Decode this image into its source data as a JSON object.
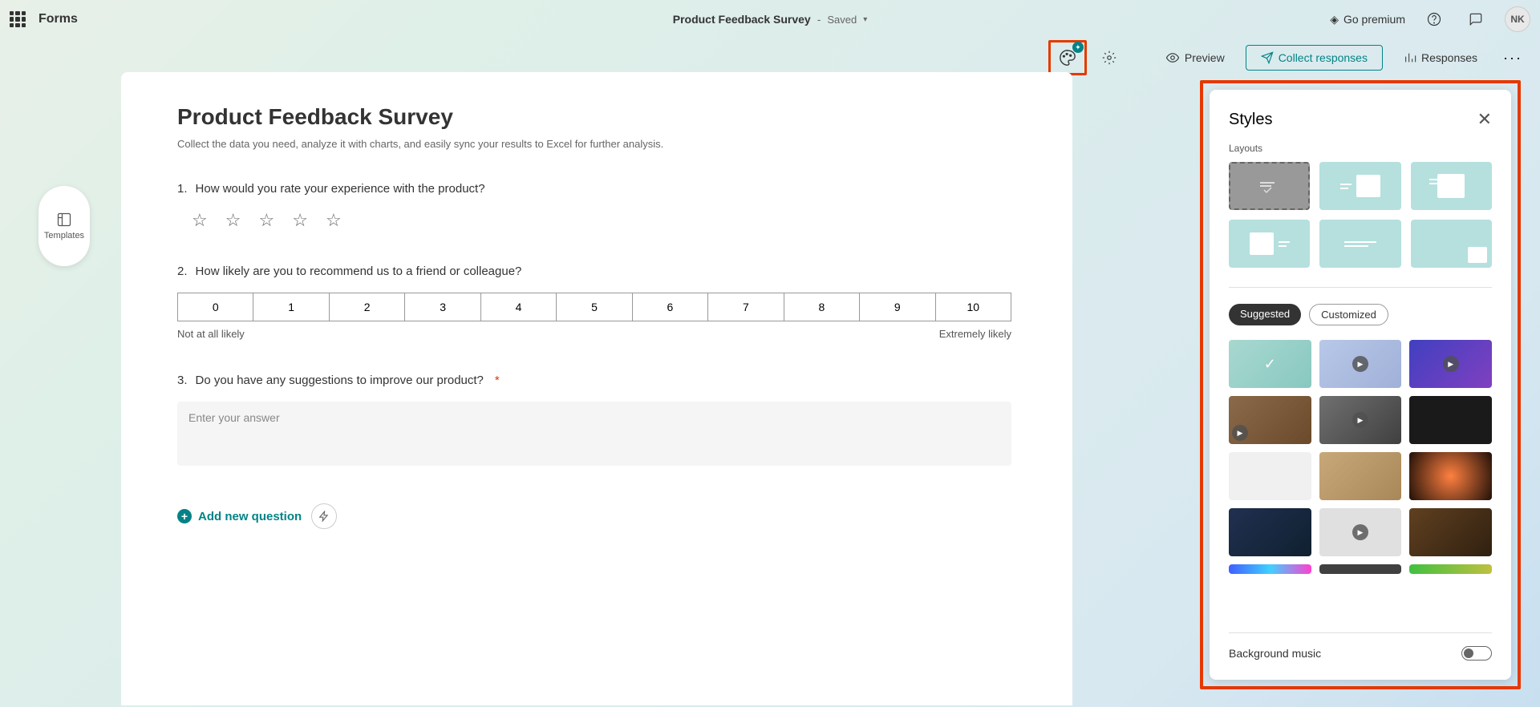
{
  "topbar": {
    "brand": "Forms",
    "doc_title": "Product Feedback Survey",
    "saved": "Saved",
    "premium": "Go premium",
    "avatar": "NK"
  },
  "toolbar": {
    "preview": "Preview",
    "collect": "Collect responses",
    "responses": "Responses"
  },
  "templates_tab": "Templates",
  "form": {
    "title": "Product Feedback Survey",
    "description": "Collect the data you need, analyze it with charts, and easily sync your results to Excel for further analysis.",
    "q1": {
      "num": "1.",
      "text": "How would you rate your experience with the product?"
    },
    "q2": {
      "num": "2.",
      "text": "How likely are you to recommend us to a friend or colleague?",
      "options": [
        "0",
        "1",
        "2",
        "3",
        "4",
        "5",
        "6",
        "7",
        "8",
        "9",
        "10"
      ],
      "label_left": "Not at all likely",
      "label_right": "Extremely likely"
    },
    "q3": {
      "num": "3.",
      "text": "Do you have any suggestions to improve our product?",
      "required": "*",
      "placeholder": "Enter your answer"
    },
    "add_new": "Add new question"
  },
  "styles": {
    "title": "Styles",
    "layouts_label": "Layouts",
    "tab_suggested": "Suggested",
    "tab_customized": "Customized",
    "music_label": "Background music"
  }
}
